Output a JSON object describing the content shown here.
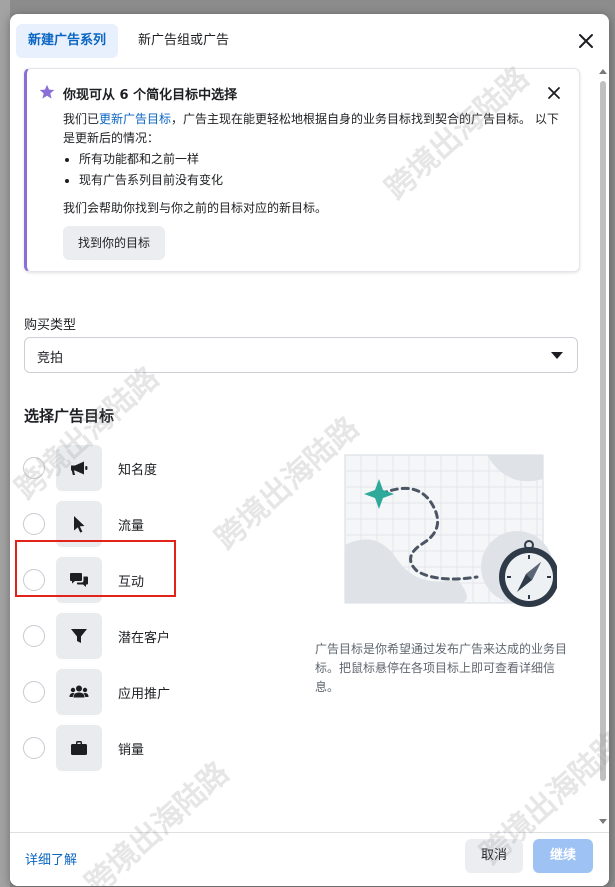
{
  "tabs": [
    {
      "label": "新建广告系列",
      "active": true
    },
    {
      "label": "新广告组或广告",
      "active": false
    }
  ],
  "notice": {
    "title": "你现可从 6 个简化目标中选择",
    "body_prefix": "我们已",
    "body_link": "更新广告目标",
    "body_suffix": "，广告主现在能更轻松地根据自身的业务目标找到契合的广告目标。 以下是更新后的情况：",
    "bullets": [
      "所有功能都和之前一样",
      "现有广告系列目前没有变化"
    ],
    "body2": "我们会帮助你找到与你之前的目标对应的新目标。",
    "button": "找到你的目标",
    "accent_color": "#8b6fd6"
  },
  "buying_type": {
    "label": "购买类型",
    "value": "竞拍"
  },
  "objective_section_title": "选择广告目标",
  "objectives": [
    {
      "label": "知名度",
      "icon": "megaphone-icon"
    },
    {
      "label": "流量",
      "icon": "cursor-icon"
    },
    {
      "label": "互动",
      "icon": "chat-bubbles-icon"
    },
    {
      "label": "潜在客户",
      "icon": "funnel-icon"
    },
    {
      "label": "应用推广",
      "icon": "people-icon"
    },
    {
      "label": "销量",
      "icon": "briefcase-icon"
    }
  ],
  "description": "广告目标是你希望通过发布广告来达成的业务目标。把鼠标悬停在各项目标上即可查看详细信息。",
  "footer": {
    "learn_more": "详细了解",
    "cancel": "取消",
    "continue": "继续"
  },
  "watermark": "跨境出海陆路",
  "colors": {
    "primary": "#0a66c2",
    "continue_disabled": "#9ec2f3",
    "highlight": "#e2231a"
  }
}
